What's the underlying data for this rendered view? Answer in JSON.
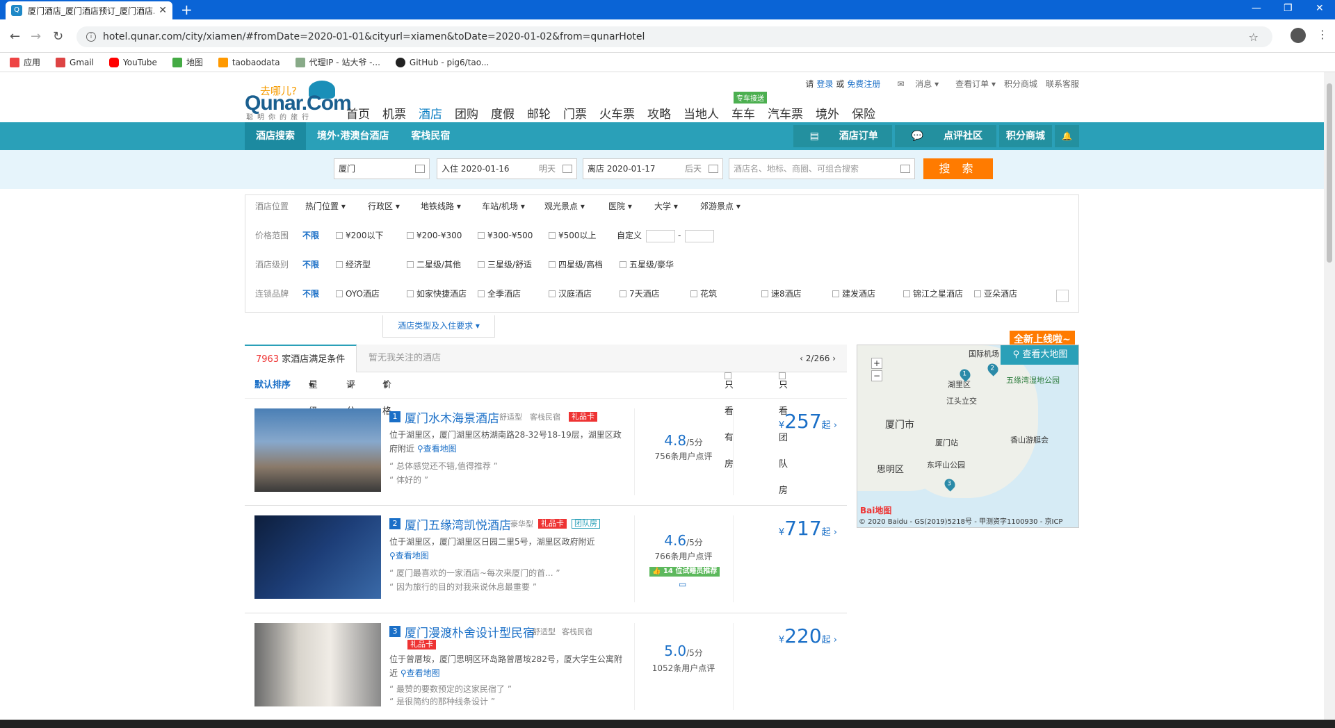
{
  "browser": {
    "tab_title": "厦门酒店_厦门酒店预订_厦门酒店...",
    "url": "hotel.qunar.com/city/xiamen/#fromDate=2020-01-01&cityurl=xiamen&toDate=2020-01-02&from=qunarHotel",
    "bookmarks": [
      "应用",
      "Gmail",
      "YouTube",
      "地图",
      "taobaodata",
      "代理IP - 站大爷 -...",
      "GitHub - pig6/tao..."
    ]
  },
  "header": {
    "logo_top": "去哪儿?",
    "logo_main": "Qunar.Com",
    "logo_sub": "聪明你的旅行",
    "nav": [
      "首页",
      "机票",
      "酒店",
      "团购",
      "度假",
      "邮轮",
      "门票",
      "火车票",
      "攻略",
      "当地人",
      "车车",
      "汽车票",
      "境外",
      "保险"
    ],
    "active_nav": "酒店",
    "car_tag": "专车接送",
    "top_links": {
      "please": "请",
      "login": "登录",
      "or": "或",
      "register": "免费注册",
      "messages": "消息",
      "orders": "查看订单",
      "mall": "积分商城",
      "service": "联系客服"
    }
  },
  "subnav": {
    "left": [
      "酒店搜索",
      "境外·港澳台酒店",
      "客栈民宿"
    ],
    "right": [
      "酒店订单",
      "点评社区",
      "积分商城",
      "🔔"
    ]
  },
  "search": {
    "city": "厦门",
    "checkin": "入住 2020-01-16",
    "checkin_hint": "明天",
    "checkout": "离店 2020-01-17",
    "checkout_hint": "后天",
    "keyword_placeholder": "酒店名、地标、商圈、可组合搜索",
    "button": "搜 索"
  },
  "filters": {
    "location": {
      "label": "酒店位置",
      "items": [
        "热门位置",
        "行政区",
        "地铁线路",
        "车站/机场",
        "观光景点",
        "医院",
        "大学",
        "郊游景点"
      ]
    },
    "price": {
      "label": "价格范围",
      "any": "不限",
      "items": [
        "¥200以下",
        "¥200-¥300",
        "¥300-¥500",
        "¥500以上"
      ],
      "custom": "自定义",
      "dash": "-"
    },
    "level": {
      "label": "酒店级别",
      "any": "不限",
      "items": [
        "经济型",
        "二星级/其他",
        "三星级/舒适",
        "四星级/高档",
        "五星级/豪华"
      ]
    },
    "brand": {
      "label": "连锁品牌",
      "any": "不限",
      "items": [
        "OYO酒店",
        "如家快捷酒店",
        "全季酒店",
        "汉庭酒店",
        "7天酒店",
        "花筑",
        "速8酒店",
        "建发酒店",
        "锦江之星酒店",
        "亚朵酒店"
      ]
    },
    "expand": "酒店类型及入住要求"
  },
  "results": {
    "count": "7963",
    "count_suffix": "家酒店满足条件",
    "followed_tab": "暂无我关注的酒店",
    "pager": "2/266",
    "sort": [
      "默认排序",
      "星级",
      "评分",
      "价格"
    ],
    "only_available": "只看有房",
    "only_group": "只看团队房"
  },
  "hotels": [
    {
      "no": "1",
      "name": "厦门水木海景酒店",
      "type": "舒适型",
      "kind": "客栈民宿",
      "badge": "礼品卡",
      "addr": "位于湖里区，厦门湖里区枋湖南路28-32号18-19层，湖里区政府附近",
      "map": "查看地图",
      "q1": "总体感觉还不错,值得推荐",
      "q2": "体好的",
      "score": "4.8",
      "of": "/5分",
      "reviews": "756条用户点评",
      "price_symbol": "¥",
      "price": "257",
      "from": "起"
    },
    {
      "no": "2",
      "name": "厦门五缘湾凯悦酒店",
      "type": "豪华型",
      "badge": "礼品卡",
      "badge2": "团队房",
      "addr": "位于湖里区，厦门湖里区日园二里5号，湖里区政府附近",
      "map": "查看地图",
      "q1": "厦门最喜欢的一家酒店~每次来厦门的首...",
      "q2": "因为旅行的目的对我来说休息最重要",
      "score": "4.6",
      "of": "/5分",
      "reviews": "766条用户点评",
      "recommend": "14 位试睡员推荐",
      "price_symbol": "¥",
      "price": "717",
      "from": "起"
    },
    {
      "no": "3",
      "name": "厦门漫渡朴舍设计型民宿",
      "type": "舒适型",
      "kind": "客栈民宿",
      "badge": "礼品卡",
      "addr": "位于曾厝垵，厦门思明区环岛路曾厝垵282号，厦大学生公寓附近",
      "map": "查看地图",
      "q1": "最赞的要数预定的这家民宿了",
      "q2": "是很简约的那种线条设计",
      "score": "5.0",
      "of": "/5分",
      "reviews": "1052条用户点评",
      "price_symbol": "¥",
      "price": "220",
      "from": "起"
    }
  ],
  "map": {
    "new_badge": "全新上线啦~",
    "view_big": "查看大地图",
    "labels": [
      "国际机场",
      "湖里区",
      "五缘湾湿地公园",
      "江头立交",
      "厦门市",
      "厦门站",
      "香山游艇会",
      "思明区",
      "东坪山公园"
    ],
    "copyright": "© 2020 Baidu - GS(2019)5218号 - 甲测资字1100930 - 京ICP",
    "baidu": "Bai地图"
  }
}
